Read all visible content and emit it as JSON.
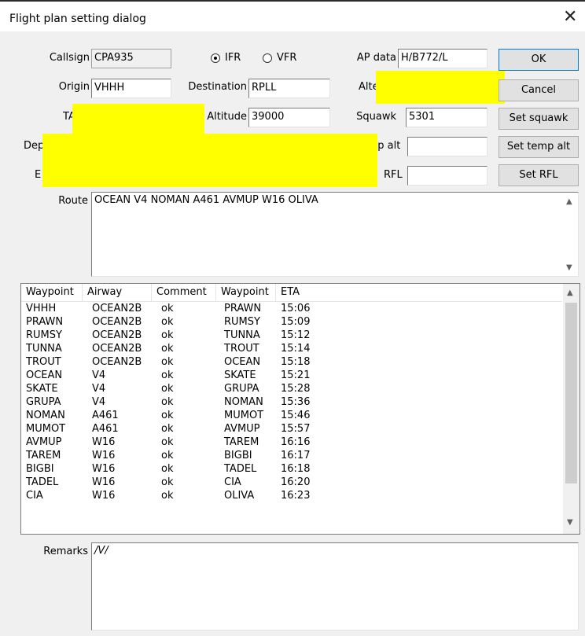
{
  "window": {
    "title": "Flight plan setting dialog",
    "close_glyph": "✕"
  },
  "fields": {
    "callsign": {
      "label": "Callsign",
      "value": "CPA935"
    },
    "flight_rules": {
      "ifr": "IFR",
      "vfr": "VFR",
      "selected": "IFR"
    },
    "ap_data": {
      "label": "AP data",
      "value": "H/B772/L"
    },
    "origin": {
      "label": "Origin",
      "value": "VHHH"
    },
    "destination": {
      "label": "Destination",
      "value": "RPLL"
    },
    "alternate": {
      "label": "Alte",
      "value": ""
    },
    "tas": {
      "label": "TA",
      "value": ""
    },
    "altitude": {
      "label": "Altitude",
      "value": "39000"
    },
    "squawk": {
      "label": "Squawk",
      "value": "5301"
    },
    "departure": {
      "label": "Dep",
      "value": ""
    },
    "temp_alt": {
      "label": "np alt",
      "value": ""
    },
    "row5_label": {
      "label": "E",
      "value": ""
    },
    "rfl": {
      "label": "RFL",
      "value": ""
    },
    "route": {
      "label": "Route",
      "value": "OCEAN V4 NOMAN A461 AVMUP W16 OLIVA"
    },
    "remarks": {
      "label": "Remarks",
      "value": "/V/"
    }
  },
  "buttons": {
    "ok": "OK",
    "cancel": "Cancel",
    "set_squawk": "Set squawk",
    "set_temp_alt": "Set temp alt",
    "set_rfl": "Set RFL"
  },
  "list": {
    "columns": [
      "Waypoint",
      "Airway",
      "Comment",
      "Waypoint",
      "ETA"
    ],
    "rows": [
      [
        "VHHH",
        "OCEAN2B",
        "ok",
        "PRAWN",
        "15:06"
      ],
      [
        "PRAWN",
        "OCEAN2B",
        "ok",
        "RUMSY",
        "15:09"
      ],
      [
        "RUMSY",
        "OCEAN2B",
        "ok",
        "TUNNA",
        "15:12"
      ],
      [
        "TUNNA",
        "OCEAN2B",
        "ok",
        "TROUT",
        "15:14"
      ],
      [
        "TROUT",
        "OCEAN2B",
        "ok",
        "OCEAN",
        "15:18"
      ],
      [
        "OCEAN",
        "V4",
        "ok",
        "SKATE",
        "15:21"
      ],
      [
        "SKATE",
        "V4",
        "ok",
        "GRUPA",
        "15:28"
      ],
      [
        "GRUPA",
        "V4",
        "ok",
        "NOMAN",
        "15:36"
      ],
      [
        "NOMAN",
        "A461",
        "ok",
        "MUMOT",
        "15:46"
      ],
      [
        "MUMOT",
        "A461",
        "ok",
        "AVMUP",
        "15:57"
      ],
      [
        "AVMUP",
        "W16",
        "ok",
        "TAREM",
        "16:16"
      ],
      [
        "TAREM",
        "W16",
        "ok",
        "BIGBI",
        "16:17"
      ],
      [
        "BIGBI",
        "W16",
        "ok",
        "TADEL",
        "16:18"
      ],
      [
        "TADEL",
        "W16",
        "ok",
        "CIA",
        "16:20"
      ],
      [
        "CIA",
        "W16",
        "ok",
        "OLIVA",
        "16:23"
      ]
    ]
  },
  "colors": {
    "redaction": "#ffff00",
    "face": "#f0f0f0",
    "accent": "#0078d7"
  }
}
